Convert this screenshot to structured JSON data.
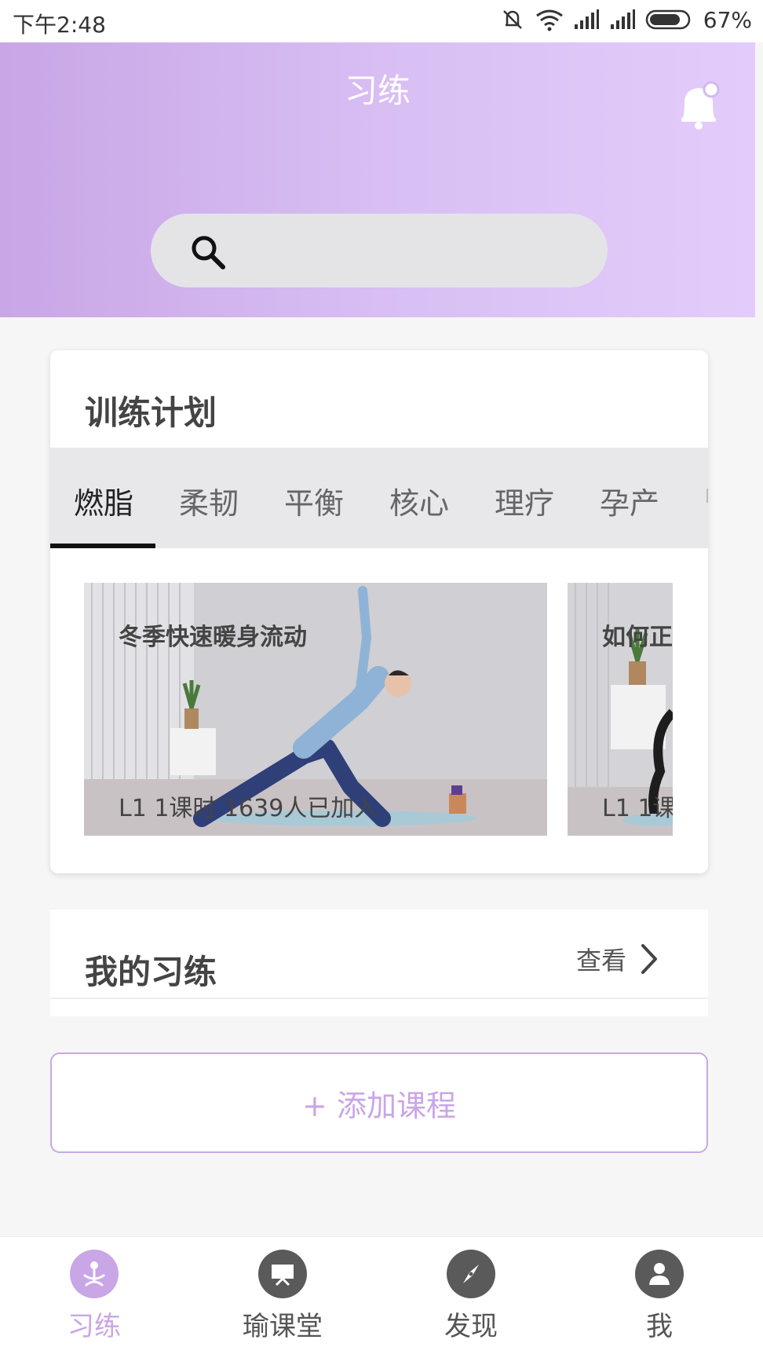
{
  "status_bar": {
    "time": "下午2:48",
    "battery": "67%",
    "icons": [
      "mute-icon",
      "wifi-icon",
      "signal-icon",
      "signal-icon",
      "battery-icon"
    ]
  },
  "header": {
    "title": "习练",
    "search_placeholder": "",
    "colors": {
      "gradient_start": "#c9a6e6",
      "gradient_end": "#e3ccfb"
    }
  },
  "training_plan": {
    "title": "训练计划",
    "tabs": [
      {
        "label": "燃脂",
        "active": true
      },
      {
        "label": "柔韧",
        "active": false
      },
      {
        "label": "平衡",
        "active": false
      },
      {
        "label": "核心",
        "active": false
      },
      {
        "label": "理疗",
        "active": false
      },
      {
        "label": "孕产",
        "active": false
      }
    ],
    "courses": [
      {
        "title": "冬季快速暖身流动",
        "meta": "L1 1课时 1639人已加入"
      },
      {
        "title": "如何正",
        "meta": "L1 1课"
      }
    ]
  },
  "my_practice": {
    "title": "我的习练",
    "view_label": "查看"
  },
  "add_course": {
    "label": "+ 添加课程"
  },
  "bottom_nav": {
    "items": [
      {
        "label": "习练",
        "icon": "yoga-icon",
        "active": true
      },
      {
        "label": "瑜课堂",
        "icon": "classroom-icon",
        "active": false
      },
      {
        "label": "发现",
        "icon": "compass-icon",
        "active": false
      },
      {
        "label": "我",
        "icon": "user-icon",
        "active": false
      }
    ]
  },
  "accent_color": "#c9a6e6"
}
